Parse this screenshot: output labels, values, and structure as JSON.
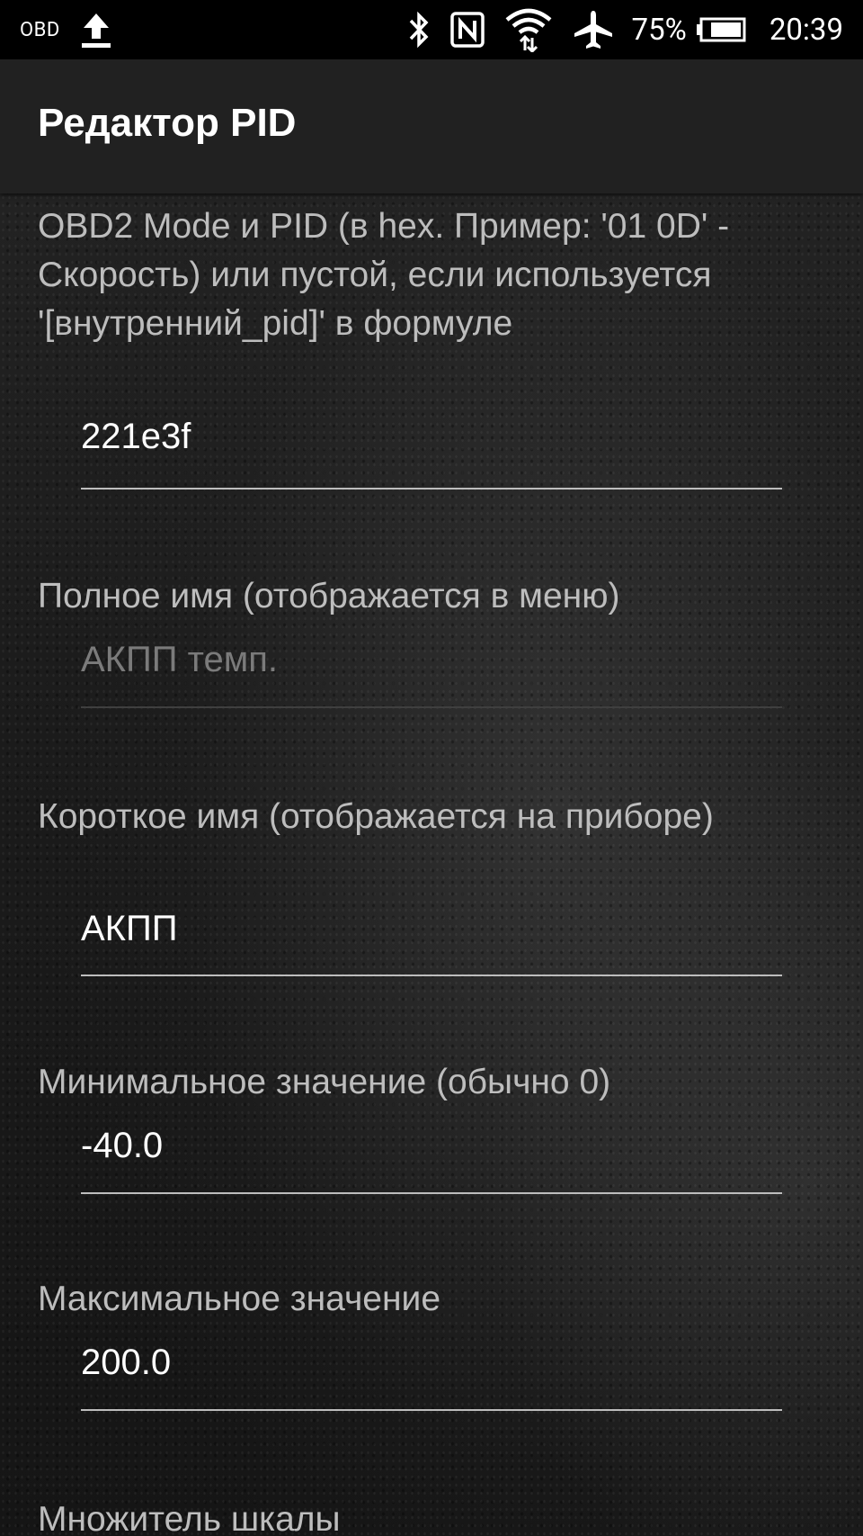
{
  "status_bar": {
    "obd_label": "OBD",
    "battery_percent": "75%",
    "time": "20:39",
    "icons": [
      "upload-icon",
      "bluetooth-icon",
      "nfc-icon",
      "wifi-icon",
      "airplane-icon",
      "battery-icon"
    ]
  },
  "toolbar": {
    "title": "Редактор PID"
  },
  "fields": [
    {
      "label": "OBD2 Mode и PID (в hex. Пример: '01 0D' - Скорость) или пустой, если используется '[внутренний_pid]' в формуле",
      "value": "221e3f",
      "placeholder": ""
    },
    {
      "label": "Полное имя (отображается в меню)",
      "value": "",
      "placeholder": "АКПП темп."
    },
    {
      "label": "Короткое имя (отображается на приборе)",
      "value": "АКПП",
      "placeholder": ""
    },
    {
      "label": "Минимальное значение (обычно 0)",
      "value": "-40.0",
      "placeholder": ""
    },
    {
      "label": "Максимальное значение",
      "value": "200.0",
      "placeholder": ""
    },
    {
      "label": "Множитель шкалы",
      "value": "",
      "placeholder": ""
    }
  ]
}
